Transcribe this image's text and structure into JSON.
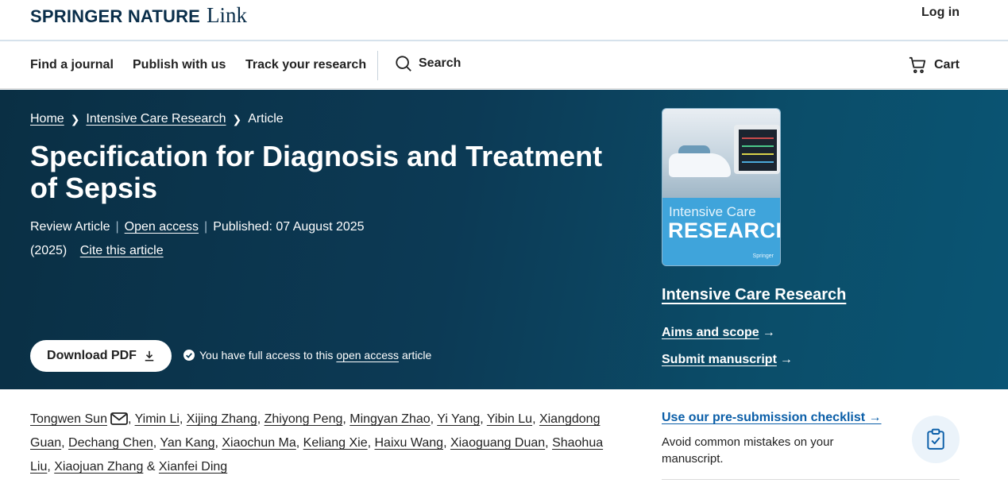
{
  "header": {
    "logo_brand": "SPRINGER NATURE",
    "logo_link": "Link",
    "login": "Log in"
  },
  "nav": {
    "items": [
      "Find a journal",
      "Publish with us",
      "Track your research"
    ],
    "search": "Search",
    "cart": "Cart"
  },
  "breadcrumb": {
    "home": "Home",
    "journal": "Intensive Care Research",
    "current": "Article"
  },
  "article": {
    "title": "Specification for Diagnosis and Treatment of Sepsis",
    "type": "Review Article",
    "open_access": "Open access",
    "published": "Published: 07 August 2025",
    "year": "(2025)",
    "cite": "Cite this article",
    "download_label": "Download PDF",
    "access_prefix": "You have full access to this",
    "access_link": "open access",
    "access_suffix": "article"
  },
  "journal": {
    "cover_title_line1": "Intensive Care",
    "cover_title_line2": "RESEARCH",
    "cover_publisher": "Springer",
    "name": "Intensive Care Research",
    "aims": "Aims and scope",
    "submit": "Submit manuscript"
  },
  "authors": [
    "Tongwen Sun",
    "Yimin Li",
    "Xijing Zhang",
    "Zhiyong Peng",
    "Mingyan Zhao",
    "Yi Yang",
    "Yibin Lu",
    "Xiangdong Guan",
    "Dechang Chen",
    "Yan Kang",
    "Xiaochun Ma",
    "Keliang Xie",
    "Haixu Wang",
    "Xiaoguang Duan",
    "Shaohua Liu",
    "Xiaojuan Zhang",
    "Xianfei Ding"
  ],
  "authors_and": "&",
  "checklist": {
    "link": "Use our pre-submission checklist",
    "description": "Avoid common mistakes on your manuscript."
  },
  "icons": {
    "search": "search-icon",
    "cart": "cart-icon",
    "download": "download-icon",
    "check": "check-circle-icon",
    "mail": "mail-icon",
    "clipboard": "clipboard-check-icon"
  },
  "colors": {
    "hero_bg": "#0c3a55",
    "brand_navy": "#0a2e4a",
    "link_blue": "#0a5ea8"
  }
}
